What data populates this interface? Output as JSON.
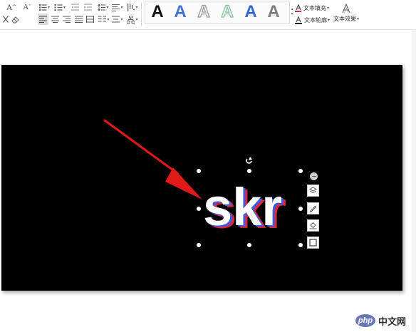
{
  "ribbon": {
    "font_grow_label": "A",
    "font_shrink_label": "A",
    "text_fill_label": "文本填充",
    "text_outline_label": "文本轮廓",
    "text_effect_label": "文本效果",
    "art_styles": [
      {
        "glyph": "A",
        "name": "black-fill"
      },
      {
        "glyph": "A",
        "name": "blue-fill"
      },
      {
        "glyph": "A",
        "name": "gray-outline"
      },
      {
        "glyph": "A",
        "name": "green-outline"
      },
      {
        "glyph": "A",
        "name": "blue-bold"
      },
      {
        "glyph": "A",
        "name": "gray-gradient"
      }
    ]
  },
  "slide": {
    "text": "skr",
    "colors": {
      "background": "#000000",
      "text": "#ffffff",
      "shadow_red": "#e0263c",
      "shadow_blue": "#3c5edc",
      "arrow": "#e01919"
    }
  },
  "watermark": {
    "logo": "php",
    "text": "中文网"
  }
}
